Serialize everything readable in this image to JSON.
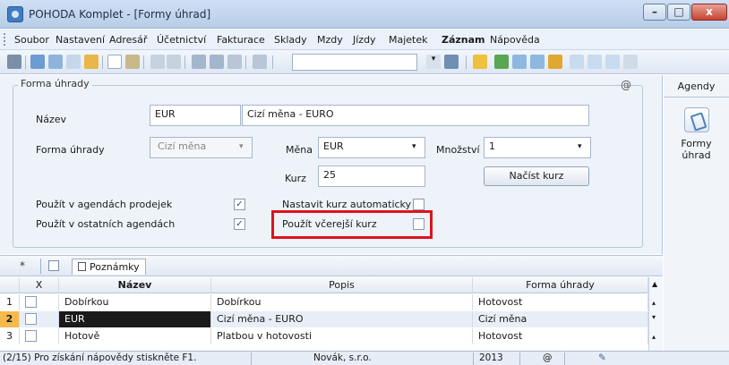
{
  "window": {
    "title": "POHODA Komplet - [Formy úhrad]",
    "controls": {
      "minimize": "–",
      "maximize": "□",
      "close": "x"
    }
  },
  "menu": {
    "items": [
      "Soubor",
      "Nastavení",
      "Adresář",
      "Účetnictví",
      "Fakturace",
      "Sklady",
      "Mzdy",
      "Jízdy",
      "Majetek",
      "Záznam",
      "Nápověda"
    ],
    "bold_item": "Záznam"
  },
  "form": {
    "group_title": "Forma úhrady",
    "at_symbol": "@",
    "nazev_label": "Název",
    "nazev_code": "EUR",
    "nazev_text": "Cizí měna - EURO",
    "forma_label": "Forma úhrady",
    "forma_value": "Cizí měna",
    "mena_label": "Měna",
    "mena_value": "EUR",
    "mnozstvi_label": "Množství",
    "mnozstvi_value": "1",
    "kurz_label": "Kurz",
    "kurz_value": "25",
    "nacist_button": "Načíst kurz",
    "prodejek_label": "Použít v agendách prodejek",
    "prodejek_checked": true,
    "ostatnich_label": "Použít v ostatních agendách",
    "ostatnich_checked": true,
    "auto_label": "Nastavit kurz automaticky",
    "auto_checked": false,
    "vcerejsi_label": "Použít včerejší kurz",
    "vcerejsi_checked": false
  },
  "agendy": {
    "title": "Agendy",
    "item_label_1": "Formy",
    "item_label_2": "úhrad"
  },
  "tabs": {
    "star": "*",
    "poznamky": "Poznámky"
  },
  "table": {
    "headers": {
      "x": "X",
      "nazev": "Název",
      "popis": "Popis",
      "forma": "Forma úhrady"
    },
    "rows": [
      {
        "num": "1",
        "nazev": "Dobírkou",
        "popis": "Dobírkou",
        "forma": "Hotovost"
      },
      {
        "num": "2",
        "nazev": "EUR",
        "popis": "Cizí měna - EURO",
        "forma": "Cizí měna"
      },
      {
        "num": "3",
        "nazev": "Hotově",
        "popis": "Platbou v hotovosti",
        "forma": "Hotovost"
      }
    ],
    "selected_row": 2
  },
  "status": {
    "help": "(2/15) Pro získání nápovědy stiskněte F1.",
    "company": "Novák, s.r.o.",
    "year": "2013",
    "at": "@"
  },
  "colors": {
    "highlight_border": "#e0121c",
    "selected_cell": "#1a1a1a",
    "titlebar": "#b7cde8"
  }
}
